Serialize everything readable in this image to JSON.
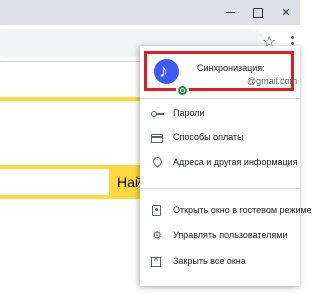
{
  "browser": {
    "star_icon": "☆",
    "window_controls": {
      "close": "✕"
    }
  },
  "page": {
    "search_button_label": "Най"
  },
  "menu": {
    "sync": {
      "title": "Синхронизация:",
      "email": "@gmail.com",
      "avatar_icon": "music-note-icon",
      "badge_color": "#1e8e3e",
      "highlight_color": "#e01d24"
    },
    "items_group1": [
      {
        "label": "Пароли",
        "icon": "key-icon"
      },
      {
        "label": "Способы оплаты",
        "icon": "credit-card-icon"
      },
      {
        "label": "Адреса и другая информация",
        "icon": "location-pin-icon"
      }
    ],
    "items_group2": [
      {
        "label": "Открыть окно в гостевом режиме",
        "icon": "guest-icon"
      },
      {
        "label": "Управлять пользователями",
        "icon": "gear-icon",
        "glyph": "⚙"
      },
      {
        "label": "Закрыть все окна",
        "icon": "close-windows-icon"
      }
    ]
  },
  "colors": {
    "accent_yellow": "#ffd93d",
    "avatar_blue": "#3d5afe"
  }
}
